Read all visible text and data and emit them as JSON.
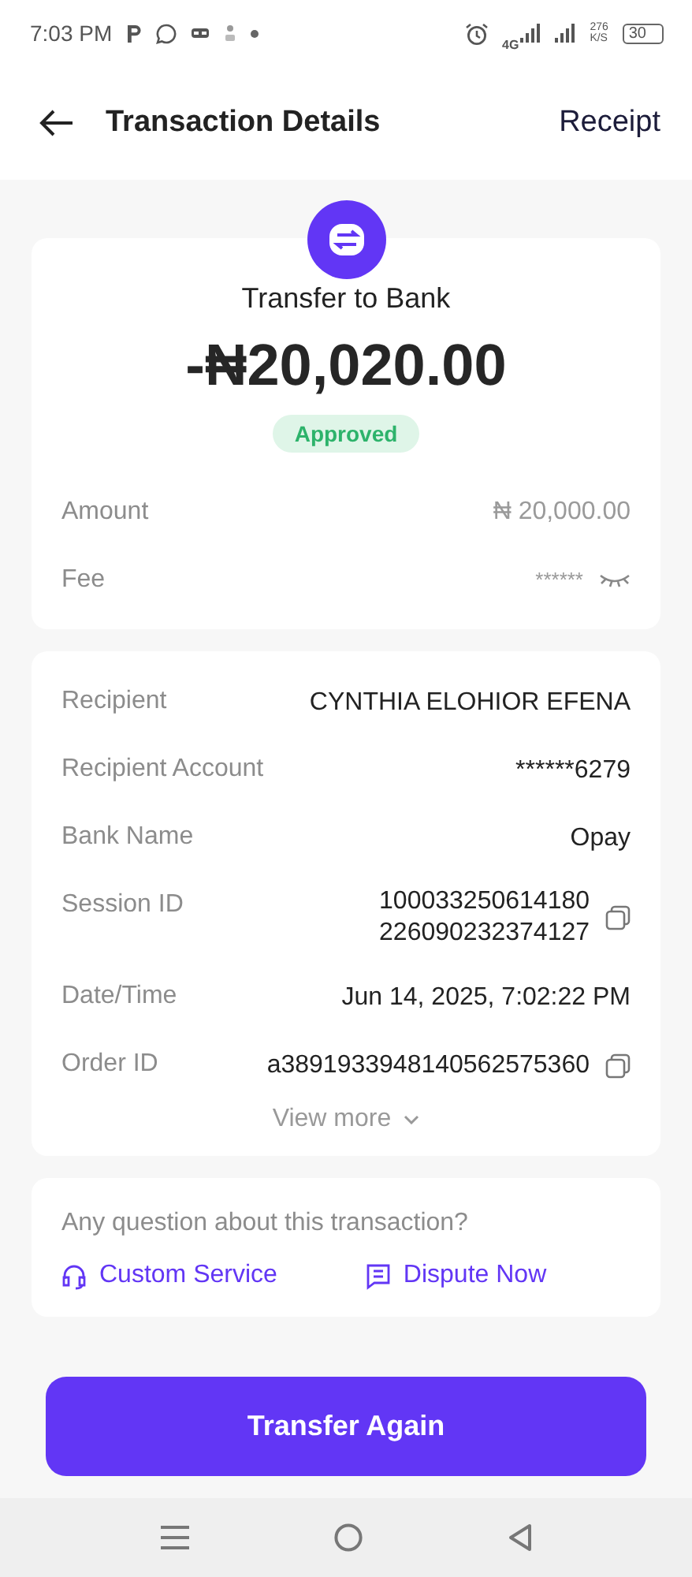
{
  "status_bar": {
    "time": "7:03 PM",
    "network": "4G",
    "speed": "276",
    "speed_unit": "K/S",
    "battery": "30"
  },
  "header": {
    "title": "Transaction Details",
    "action": "Receipt"
  },
  "summary": {
    "title": "Transfer to Bank",
    "amount": "-₦20,020.00",
    "status": "Approved",
    "rows": [
      {
        "kind": "text",
        "label": "Amount",
        "value": "₦ 20,000.00"
      },
      {
        "kind": "masked",
        "label": "Fee",
        "value": "******"
      }
    ]
  },
  "details": {
    "rows": [
      {
        "kind": "text",
        "label": "Recipient",
        "value": "CYNTHIA ELOHIOR EFENA",
        "wrap": false
      },
      {
        "kind": "text",
        "label": "Recipient Account",
        "value": "******6279",
        "wrap": false
      },
      {
        "kind": "text",
        "label": "Bank Name",
        "value": "Opay",
        "wrap": false
      },
      {
        "kind": "copy",
        "label": "Session ID",
        "value": "100033250614180226090232374127",
        "wrap": true
      },
      {
        "kind": "text",
        "label": "Date/Time",
        "value": "Jun 14, 2025, 7:02:22 PM",
        "wrap": false
      },
      {
        "kind": "copy",
        "label": "Order ID",
        "value": "a3891933948140562575360",
        "wrap": false
      }
    ],
    "view_more": "View more"
  },
  "help": {
    "question": "Any question about this transaction?",
    "links": [
      {
        "kind": "service",
        "label": "Custom Service"
      },
      {
        "kind": "dispute",
        "label": "Dispute Now"
      }
    ]
  },
  "primary_button": "Transfer Again"
}
